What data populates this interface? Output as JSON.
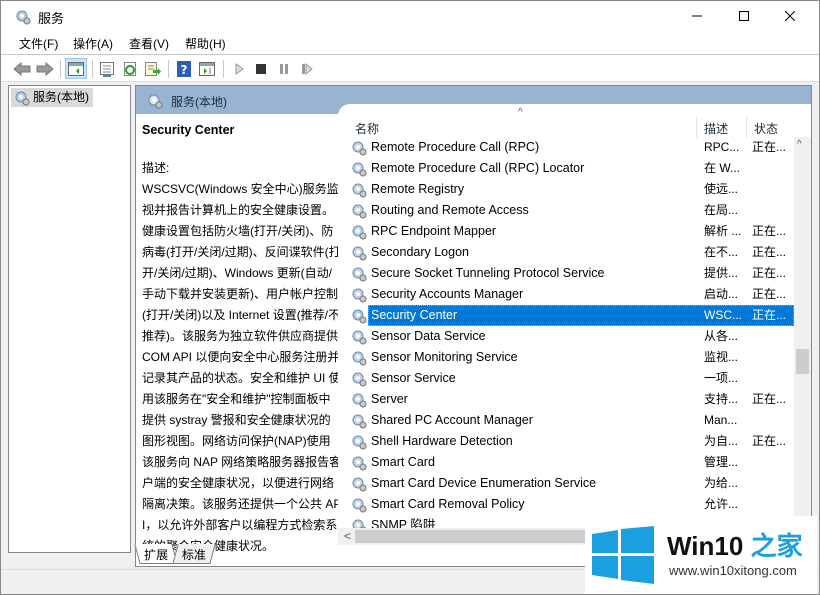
{
  "window": {
    "title": "服务",
    "controls": {
      "minimize": "minimize",
      "maximize": "maximize",
      "close": "close"
    }
  },
  "menu": [
    "文件(F)",
    "操作(A)",
    "查看(V)",
    "帮助(H)"
  ],
  "toolbar": {
    "icons": [
      "back-arrow-icon",
      "forward-arrow-icon",
      "show-hide-console-tree-icon",
      "properties-icon",
      "refresh-icon",
      "export-list-icon",
      "help-icon",
      "show-hide-action-pane-icon",
      "start-service-icon",
      "stop-service-icon",
      "pause-service-icon",
      "restart-service-icon"
    ]
  },
  "tree": {
    "item": "服务(本地)"
  },
  "pane": {
    "header": "服务(本地)",
    "selected_service": "Security Center",
    "description_label": "描述:",
    "description": "WSCSVC(Windows 安全中心)服务监视并报告计算机上的安全健康设置。健康设置包括防火墙(打开/关闭)、防病毒(打开/关闭/过期)、反间谍软件(打开/关闭/过期)、Windows 更新(自动/手动下载并安装更新)、用户帐户控制(打开/关闭)以及 Internet 设置(推荐/不推荐)。该服务为独立软件供应商提供 COM API 以便向安全中心服务注册并记录其产品的状态。安全和维护 UI 使用该服务在\"安全和维护\"控制面板中提供 systray 警报和安全健康状况的图形视图。网络访问保护(NAP)使用该服务向 NAP 网络策略服务器报告客户端的安全健康状况，以便进行网络隔离决策。该服务还提供一个公共 API，以允许外部客户以编程方式检索系统的聚合安全健康状况。"
  },
  "list": {
    "columns": {
      "name": "名称",
      "description": "描述",
      "status": "状态"
    },
    "rows": [
      {
        "name": "Remote Procedure Call (RPC)",
        "description": "RPC...",
        "status": "正在..."
      },
      {
        "name": "Remote Procedure Call (RPC) Locator",
        "description": "在 W...",
        "status": ""
      },
      {
        "name": "Remote Registry",
        "description": "使远...",
        "status": ""
      },
      {
        "name": "Routing and Remote Access",
        "description": "在局...",
        "status": ""
      },
      {
        "name": "RPC Endpoint Mapper",
        "description": "解析 ...",
        "status": "正在..."
      },
      {
        "name": "Secondary Logon",
        "description": "在不...",
        "status": "正在..."
      },
      {
        "name": "Secure Socket Tunneling Protocol Service",
        "description": "提供...",
        "status": "正在..."
      },
      {
        "name": "Security Accounts Manager",
        "description": "启动...",
        "status": "正在..."
      },
      {
        "name": "Security Center",
        "description": "WSC...",
        "status": "正在...",
        "selected": true
      },
      {
        "name": "Sensor Data Service",
        "description": "从各...",
        "status": ""
      },
      {
        "name": "Sensor Monitoring Service",
        "description": "监视...",
        "status": ""
      },
      {
        "name": "Sensor Service",
        "description": "一项...",
        "status": ""
      },
      {
        "name": "Server",
        "description": "支持...",
        "status": "正在..."
      },
      {
        "name": "Shared PC Account Manager",
        "description": "Man...",
        "status": ""
      },
      {
        "name": "Shell Hardware Detection",
        "description": "为自...",
        "status": "正在..."
      },
      {
        "name": "Smart Card",
        "description": "管理...",
        "status": ""
      },
      {
        "name": "Smart Card Device Enumeration Service",
        "description": "为给...",
        "status": ""
      },
      {
        "name": "Smart Card Removal Policy",
        "description": "允许...",
        "status": ""
      },
      {
        "name": "SNMP 陷阱",
        "description": "",
        "status": ""
      }
    ]
  },
  "tabs": [
    "扩展",
    "标准"
  ],
  "watermark": {
    "title_latin": "Win10",
    "title_cn": "之家",
    "url": "www.win10xitong.com",
    "accent": "#1aa0e0"
  },
  "colors": {
    "selection": "#0078d7",
    "pane_header": "#99b4d1"
  }
}
